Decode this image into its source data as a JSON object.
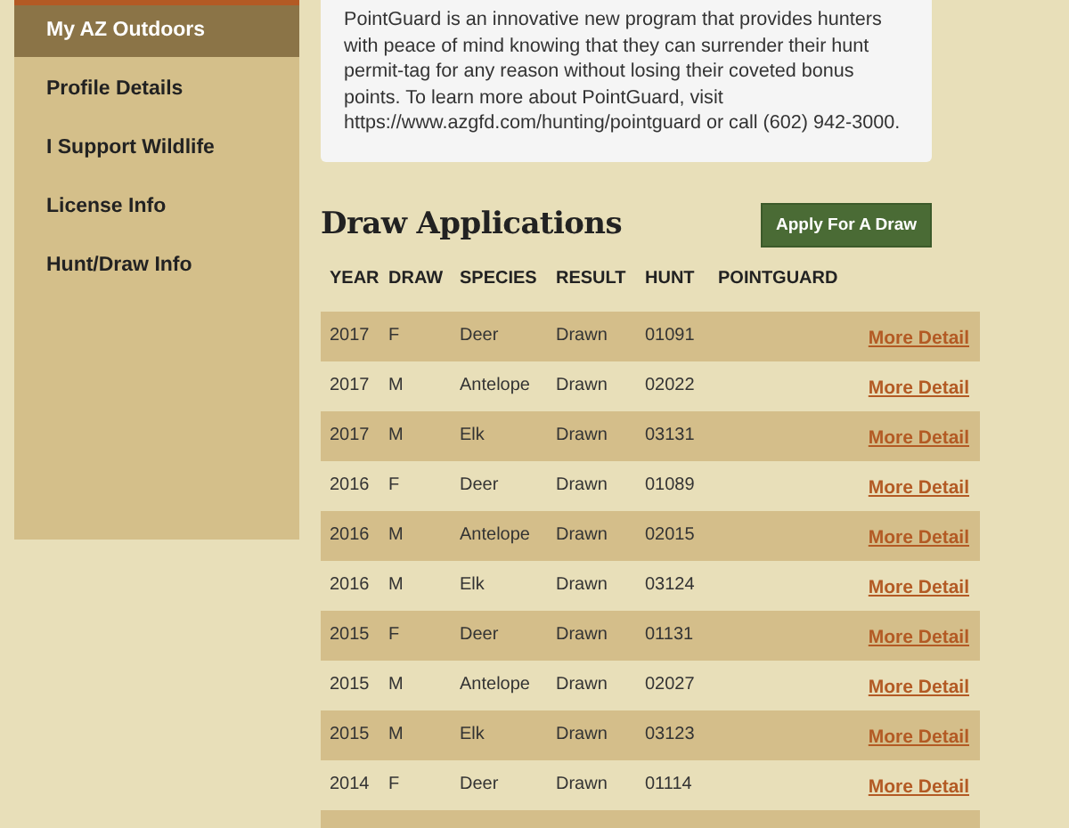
{
  "sidebar": {
    "items": [
      {
        "label": "My AZ Outdoors",
        "selected": true
      },
      {
        "label": "Profile Details",
        "selected": false
      },
      {
        "label": "I Support Wildlife",
        "selected": false
      },
      {
        "label": "License Info",
        "selected": false
      },
      {
        "label": "Hunt/Draw Info",
        "selected": false
      }
    ]
  },
  "notice": "PointGuard is an innovative new program that provides hunters with peace of mind knowing that they can surrender their hunt permit-tag for any reason without losing their coveted bonus points. To learn more about PointGuard, visit https://www.azgfd.com/hunting/pointguard or call (602) 942-3000.",
  "draw_applications": {
    "title": "Draw Applications",
    "apply_button": "Apply For A Draw",
    "columns": [
      "YEAR",
      "DRAW",
      "SPECIES",
      "RESULT",
      "HUNT",
      "POINTGUARD"
    ],
    "rows": [
      {
        "year": "2017",
        "draw": "F",
        "species": "Deer",
        "result": "Drawn",
        "hunt": "01091",
        "link": "More Detail"
      },
      {
        "year": "2017",
        "draw": "M",
        "species": "Antelope",
        "result": "Drawn",
        "hunt": "02022",
        "link": "More Detail"
      },
      {
        "year": "2017",
        "draw": "M",
        "species": "Elk",
        "result": "Drawn",
        "hunt": "03131",
        "link": "More Detail"
      },
      {
        "year": "2016",
        "draw": "F",
        "species": "Deer",
        "result": "Drawn",
        "hunt": "01089",
        "link": "More Detail"
      },
      {
        "year": "2016",
        "draw": "M",
        "species": "Antelope",
        "result": "Drawn",
        "hunt": "02015",
        "link": "More Detail"
      },
      {
        "year": "2016",
        "draw": "M",
        "species": "Elk",
        "result": "Drawn",
        "hunt": "03124",
        "link": "More Detail"
      },
      {
        "year": "2015",
        "draw": "F",
        "species": "Deer",
        "result": "Drawn",
        "hunt": "01131",
        "link": "More Detail"
      },
      {
        "year": "2015",
        "draw": "M",
        "species": "Antelope",
        "result": "Drawn",
        "hunt": "02027",
        "link": "More Detail"
      },
      {
        "year": "2015",
        "draw": "M",
        "species": "Elk",
        "result": "Drawn",
        "hunt": "03123",
        "link": "More Detail"
      },
      {
        "year": "2014",
        "draw": "F",
        "species": "Deer",
        "result": "Drawn",
        "hunt": "01114",
        "link": "More Detail"
      }
    ]
  }
}
